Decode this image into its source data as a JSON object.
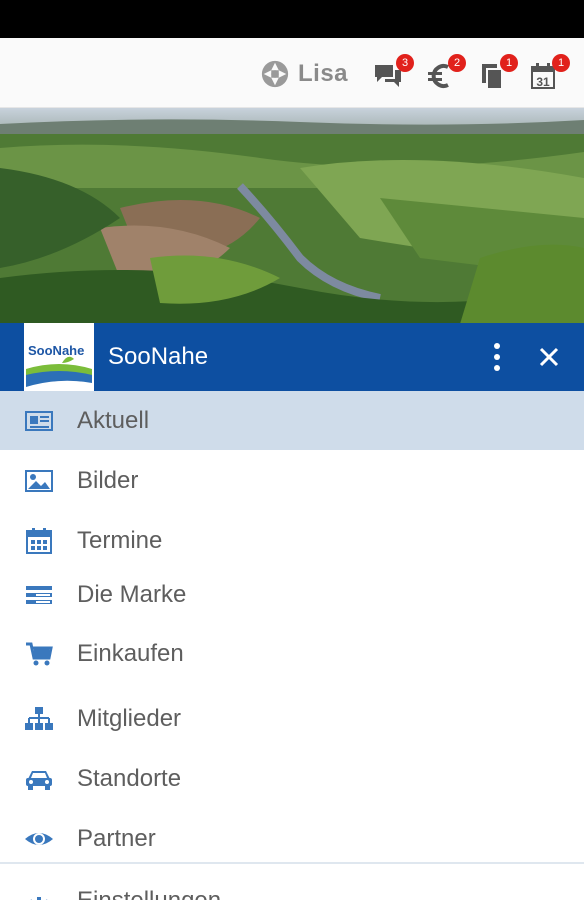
{
  "header": {
    "user_name": "Lisa",
    "icons": [
      {
        "name": "chat-icon",
        "badge": "3"
      },
      {
        "name": "euro-icon",
        "badge": "2"
      },
      {
        "name": "documents-icon",
        "badge": "1"
      },
      {
        "name": "calendar-icon",
        "badge": "1",
        "label": "31"
      }
    ]
  },
  "drawer": {
    "logo_text": "SooNahe",
    "title": "SooNahe",
    "items": [
      {
        "label": "Aktuell",
        "icon": "newspaper-icon",
        "active": true
      },
      {
        "label": "Bilder",
        "icon": "image-icon"
      },
      {
        "label": "Termine",
        "icon": "calendar-grid-icon"
      },
      {
        "label": "Die Marke",
        "icon": "list-icon"
      },
      {
        "label": "Einkaufen",
        "icon": "cart-icon"
      },
      {
        "label": "Mitglieder",
        "icon": "sitemap-icon"
      },
      {
        "label": "Standorte",
        "icon": "car-icon"
      },
      {
        "label": "Partner",
        "icon": "eye-icon"
      },
      {
        "label": "Einstellungen",
        "icon": "gear-icon"
      }
    ]
  },
  "colors": {
    "brand_blue": "#0d4fa1",
    "active_bg": "#cfdcea",
    "icon_blue": "#3a78bd",
    "badge_red": "#e1211b"
  }
}
